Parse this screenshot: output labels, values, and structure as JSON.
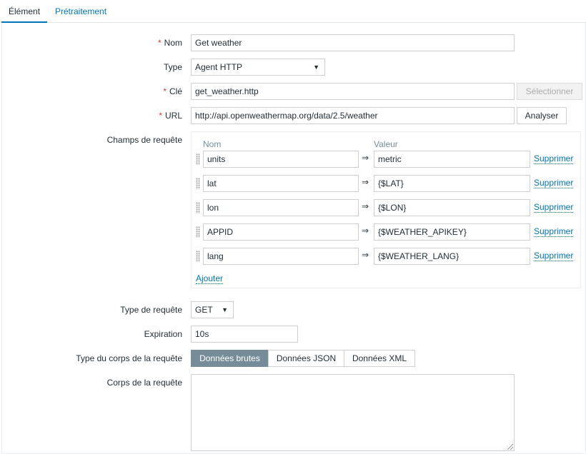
{
  "tabs": [
    "Élément",
    "Prétraitement"
  ],
  "form": {
    "name": {
      "label": "Nom",
      "value": "Get weather"
    },
    "type": {
      "label": "Type",
      "value": "Agent HTTP"
    },
    "key": {
      "label": "Clé",
      "value": "get_weather.http",
      "button": "Sélectionner"
    },
    "url": {
      "label": "URL",
      "value": "http://api.openweathermap.org/data/2.5/weather",
      "button": "Analyser"
    },
    "query_fields": {
      "label": "Champs de requête",
      "col_name": "Nom",
      "col_value": "Valeur",
      "arrow": "⇒",
      "remove": "Supprimer",
      "add": "Ajouter",
      "rows": [
        {
          "name": "units",
          "value": "metric"
        },
        {
          "name": "lat",
          "value": "{$LAT}"
        },
        {
          "name": "lon",
          "value": "{$LON}"
        },
        {
          "name": "APPID",
          "value": "{$WEATHER_APIKEY}"
        },
        {
          "name": "lang",
          "value": "{$WEATHER_LANG}"
        }
      ]
    },
    "request_type": {
      "label": "Type de requête",
      "value": "GET"
    },
    "timeout": {
      "label": "Expiration",
      "value": "10s"
    },
    "body_type": {
      "label": "Type du corps de la requête",
      "options": [
        "Données brutes",
        "Données JSON",
        "Données XML"
      ],
      "selected": "Données brutes"
    },
    "body": {
      "label": "Corps de la requête",
      "value": ""
    }
  },
  "colors": {
    "link": "#0275b8",
    "required": "#e33734",
    "selected_segment": "#768d99"
  }
}
